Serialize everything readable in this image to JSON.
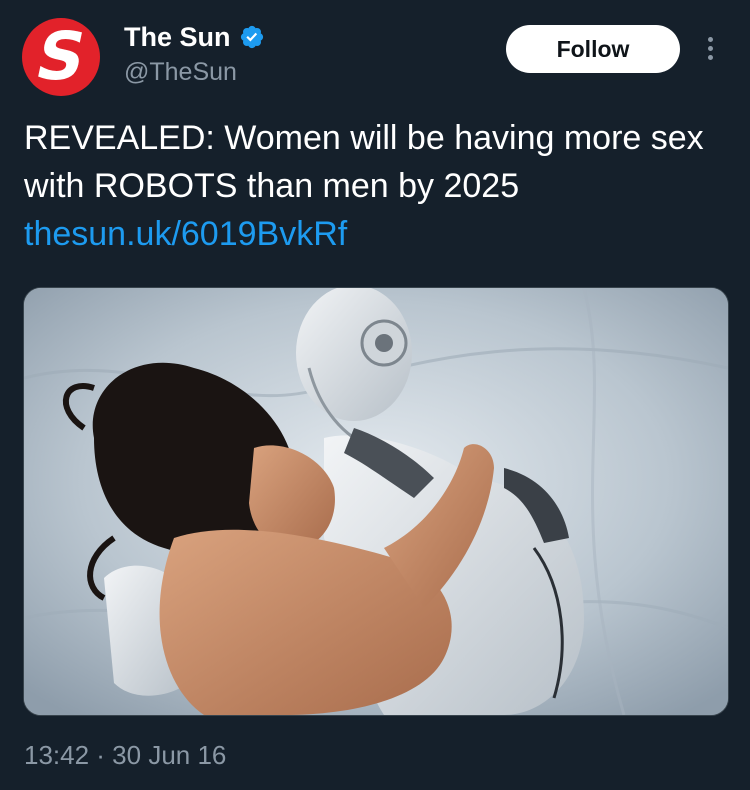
{
  "account": {
    "name": "The Sun",
    "handle": "@TheSun",
    "verified": true,
    "avatar_letter": "S",
    "avatar_color": "#e2222a"
  },
  "actions": {
    "follow_label": "Follow",
    "more_icon": "more-vertical-icon"
  },
  "tweet": {
    "text": "REVEALED: Women will be having more sex with ROBOTS than men by 2025",
    "link": "thesun.uk/6019BvkRf"
  },
  "meta": {
    "timestamp": "13:42 · 30 Jun 16"
  },
  "colors": {
    "background": "#15202b",
    "link": "#1d9bf0",
    "secondary_text": "#8b98a5",
    "verified_badge": "#1d9bf0"
  }
}
